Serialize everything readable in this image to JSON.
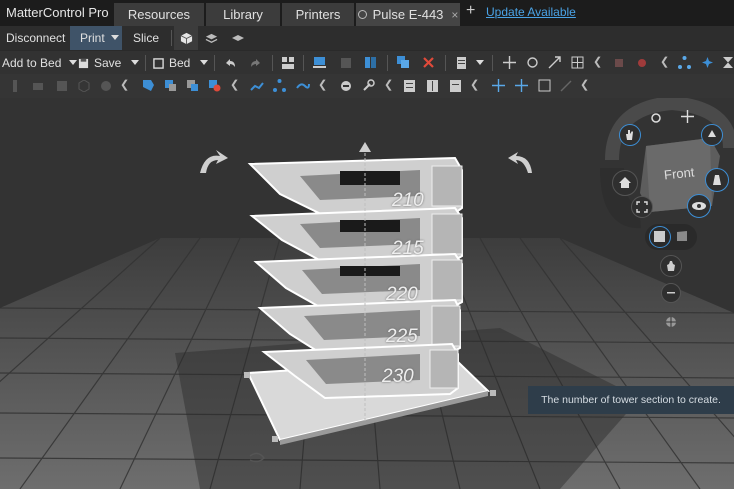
{
  "titlebar": {
    "app_title": "MatterControl Pro",
    "tabs": [
      {
        "label": "Resources"
      },
      {
        "label": "Library"
      },
      {
        "label": "Printers"
      },
      {
        "label": "Pulse E-443",
        "close": "×"
      }
    ],
    "new_tab": "+",
    "update_link": "Update Available"
  },
  "printer_bar": {
    "disconnect": "Disconnect",
    "print": "Print",
    "slice": "Slice"
  },
  "toolbar": {
    "add_to_bed": "Add to Bed",
    "save": "Save",
    "bed": "Bed"
  },
  "viewport": {
    "view_cube_label": "Front",
    "tower_labels": [
      "210",
      "215",
      "220",
      "225",
      "230"
    ],
    "tooltip": "The number of tower section to create."
  },
  "colors": {
    "accent": "#4aa3e6",
    "print_button": "#3f5368",
    "tooltip_bg": "#2e3d4a"
  }
}
